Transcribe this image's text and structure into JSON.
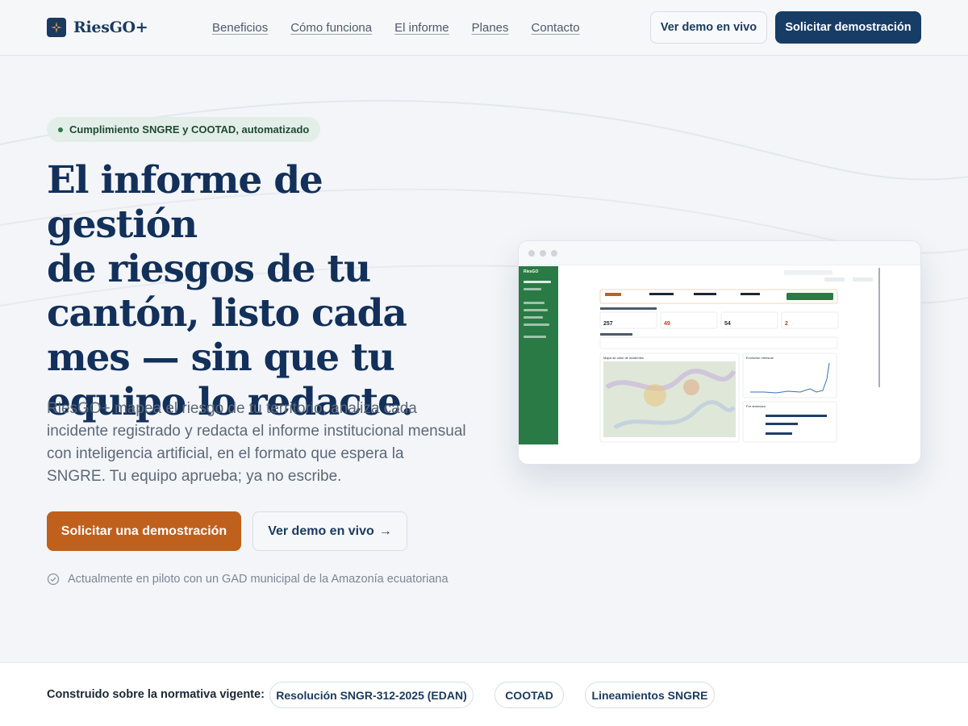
{
  "brand": {
    "name": "RiesGO+"
  },
  "nav": {
    "links": [
      "Beneficios",
      "Cómo funciona",
      "El informe",
      "Planes",
      "Contacto"
    ],
    "demo_live": "Ver demo en vivo",
    "request_demo": "Solicitar demostración"
  },
  "hero": {
    "badge": "Cumplimiento SNGRE y COOTAD, automatizado",
    "title_lines": [
      "El informe de gestión",
      "de riesgos de tu",
      "cantón, listo cada",
      "mes — sin que tu",
      "equipo lo redacte."
    ],
    "description": "RiesGO+ mapea el riesgo de tu territorio, analiza cada incidente registrado y redacta el informe institucional mensual con inteligencia artificial, en el formato que espera la SNGRE. Tu equipo aprueba; ya no escribe.",
    "cta_primary": "Solicitar una demostración",
    "cta_secondary": "Ver demo en vivo",
    "cta_secondary_arrow": "→",
    "pilot_note": "Actualmente en piloto con un GAD municipal de la Amazonía ecuatoriana"
  },
  "preview": {
    "app_name": "RiesGO",
    "kpis": [
      "257",
      "49",
      "54",
      "2"
    ],
    "map_title": "Mapa de calor de incidentes",
    "chart_title": "Evolución mensual",
    "bars_title": "Por amenaza"
  },
  "regulations": {
    "label": "Construido sobre la normativa vigente:",
    "chips": [
      "Resolución SNGR-312-2025 (EDAN)",
      "COOTAD",
      "Lineamientos SNGRE"
    ]
  },
  "colors": {
    "navy": "#173c66",
    "accent_orange": "#c0601d",
    "sidebar_green": "#2a7a45",
    "badge_bg": "#e4eee8"
  }
}
